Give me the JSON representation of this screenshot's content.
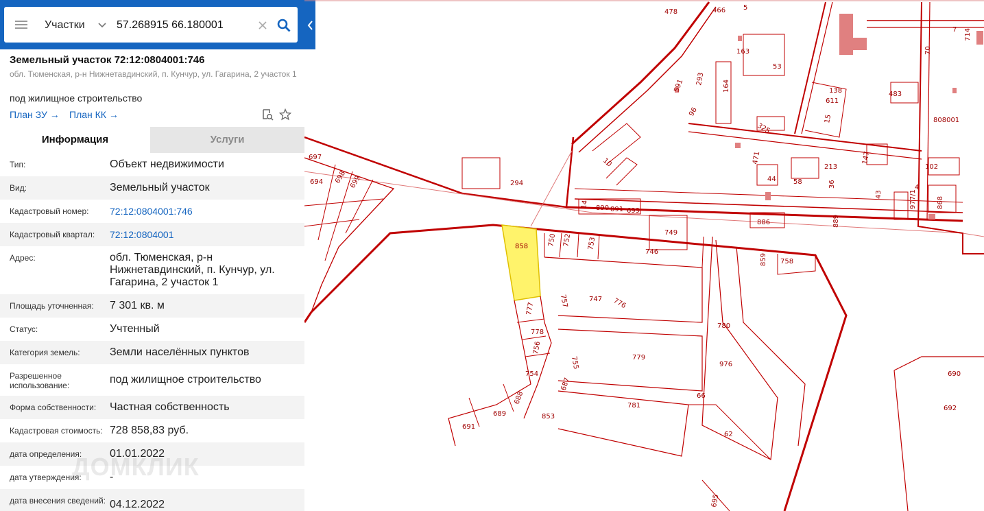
{
  "search": {
    "type_label": "Участки",
    "query": "57.268915 66.180001"
  },
  "parcel": {
    "title": "Земельный участок 72:12:0804001:746",
    "address_sub": "обл. Тюменская, р-н Нижнетавдинский, п. Кунчур, ул. Гагарина, 2 участок 1",
    "purpose": "под жилищное строительство",
    "plan_zu": "План ЗУ",
    "plan_kk": "План КК"
  },
  "tabs": {
    "info": "Информация",
    "services": "Услуги"
  },
  "info_rows": [
    {
      "label": "Тип:",
      "value": "Объект недвижимости"
    },
    {
      "label": "Вид:",
      "value": "Земельный участок"
    },
    {
      "label": "Кадастровый номер:",
      "value": "72:12:0804001:746"
    },
    {
      "label": "Кадастровый квартал:",
      "value": "72:12:0804001"
    },
    {
      "label": "Адрес:",
      "value": "обл. Тюменская, р-н Нижнетавдинский, п. Кунчур, ул. Гагарина, 2 участок 1"
    },
    {
      "label": "Площадь уточненная:",
      "value": "7 301 кв. м"
    },
    {
      "label": "Статус:",
      "value": "Учтенный"
    },
    {
      "label": "Категория земель:",
      "value": "Земли населённых пунктов"
    },
    {
      "label": "Разрешенное использование:",
      "value": "под жилищное строительство"
    },
    {
      "label": "Форма собственности:",
      "value": "Частная собственность"
    },
    {
      "label": "Кадастровая стоимость:",
      "value": "728 858,83 руб."
    },
    {
      "label": "дата определения:",
      "value": "01.01.2022"
    },
    {
      "label": "дата утверждения:",
      "value": "-"
    },
    {
      "label": "дата внесения сведений:",
      "value": "04.12.2022"
    }
  ],
  "watermark": "ДОМКЛИК",
  "map": {
    "line_color": "#c00000",
    "highlight_color": "#fff36b",
    "labels": [
      "466",
      "478",
      "5",
      "7",
      "163",
      "53",
      "70",
      "714",
      "591",
      "293",
      "164",
      "138",
      "611",
      "483",
      "15",
      "325",
      "96",
      "808001",
      "10",
      "471",
      "213",
      "147",
      "102",
      "44",
      "58",
      "36",
      "4",
      "977/1",
      "294",
      "43",
      "868",
      "886",
      "889",
      "890",
      "891",
      "699",
      "14",
      "749",
      "750",
      "752",
      "753",
      "746",
      "858",
      "859",
      "758",
      "757",
      "747",
      "776",
      "777",
      "778",
      "756",
      "754",
      "755",
      "779",
      "780",
      "781",
      "853",
      "976",
      "62",
      "66",
      "687",
      "688",
      "689",
      "691",
      "690",
      "692",
      "695",
      "694",
      "697",
      "698",
      "699"
    ]
  }
}
